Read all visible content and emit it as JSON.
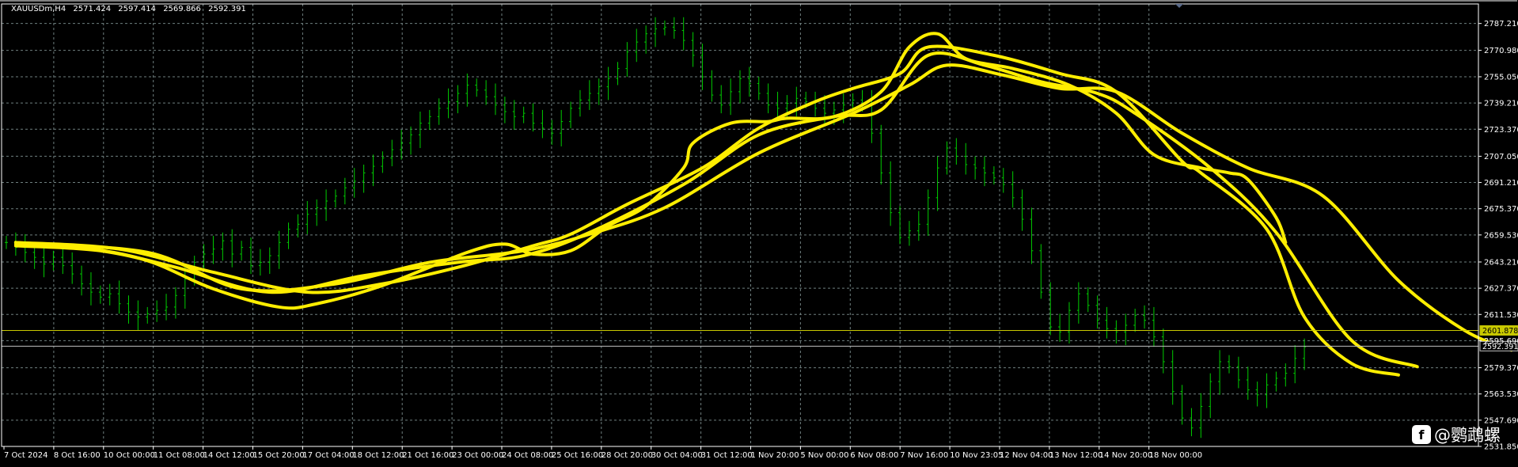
{
  "symbol_info": {
    "symbol": "XAUUSDm,H4",
    "open": "2571.424",
    "high": "2597.414",
    "low": "2569.866",
    "close": "2592.391"
  },
  "watermark": {
    "logo": "f",
    "text": "@鹦鹉螺"
  },
  "colors": {
    "background": "#000000",
    "grid": "#6f7f7f",
    "candle": "#00cc00",
    "ma": "#ffee00",
    "price_line": "#c8c800",
    "axis_text": "#ffffff"
  },
  "chart_data": {
    "type": "line",
    "title": "XAUUSDm,H4",
    "ylim": [
      2531.85,
      2799.0
    ],
    "y_ticks": [
      "2787.210",
      "2770.980",
      "2755.050",
      "2739.210",
      "2723.370",
      "2707.050",
      "2691.210",
      "2675.370",
      "2659.530",
      "2643.210",
      "2627.370",
      "2611.530",
      "2595.690",
      "2579.370",
      "2563.530",
      "2547.690",
      "2531.850"
    ],
    "x_labels": [
      "7 Oct 2024",
      "8 Oct 16:00",
      "10 Oct 00:00",
      "11 Oct 08:00",
      "14 Oct 12:00",
      "15 Oct 20:00",
      "17 Oct 04:00",
      "18 Oct 12:00",
      "21 Oct 16:00",
      "23 Oct 00:00",
      "24 Oct 08:00",
      "25 Oct 16:00",
      "28 Oct 20:00",
      "30 Oct 04:00",
      "31 Oct 12:00",
      "1 Nov 20:00",
      "5 Nov 00:00",
      "6 Nov 08:00",
      "7 Nov 16:00",
      "10 Nov 23:05",
      "12 Nov 04:00",
      "13 Nov 12:00",
      "14 Nov 20:00",
      "18 Nov 00:00"
    ],
    "price_lines": [
      {
        "value": 2601.878,
        "label": "2601.878",
        "color": "#c8c800"
      },
      {
        "value": 2592.391,
        "label": "2592.391",
        "color": "#c0c0c0"
      }
    ],
    "candles": {
      "color": "#00cc00",
      "series": [
        2655,
        2652,
        2649,
        2646,
        2642,
        2646,
        2641,
        2636,
        2630,
        2625,
        2622,
        2624,
        2618,
        2613,
        2610,
        2612,
        2614,
        2616,
        2623,
        2633,
        2643,
        2648,
        2651,
        2656,
        2648,
        2652,
        2641,
        2643,
        2647,
        2655,
        2663,
        2666,
        2672,
        2676,
        2680,
        2683,
        2688,
        2692,
        2697,
        2701,
        2706,
        2711,
        2715,
        2720,
        2727,
        2731,
        2736,
        2740,
        2745,
        2750,
        2747,
        2743,
        2738,
        2734,
        2731,
        2733,
        2727,
        2724,
        2721,
        2728,
        2736,
        2741,
        2745,
        2749,
        2754,
        2760,
        2770,
        2776,
        2781,
        2784,
        2785,
        2783,
        2777,
        2768,
        2755,
        2744,
        2738,
        2746,
        2754,
        2751,
        2745,
        2738,
        2736,
        2739,
        2742,
        2740,
        2736,
        2733,
        2735,
        2738,
        2741,
        2739,
        2721,
        2697,
        2673,
        2658,
        2662,
        2666,
        2682,
        2700,
        2712,
        2707,
        2702,
        2700,
        2697,
        2694,
        2690,
        2682,
        2669,
        2650,
        2625,
        2604,
        2601,
        2614,
        2624,
        2617,
        2608,
        2603,
        2601,
        2605,
        2611,
        2608,
        2598,
        2583,
        2565,
        2549,
        2543,
        2556,
        2571,
        2583,
        2580,
        2572,
        2566,
        2563,
        2569,
        2573,
        2576,
        2585,
        2592
      ]
    },
    "series": [
      {
        "color": "#ffee00",
        "x": [
          1,
          8,
          15,
          22,
          29,
          33,
          40,
          49,
          53,
          56,
          60,
          64,
          68,
          72,
          73,
          77,
          81,
          83,
          88,
          93,
          96,
          99,
          102,
          107,
          113,
          118,
          122,
          127,
          130,
          132,
          135,
          136
        ],
        "values": [
          2655,
          2652,
          2644,
          2627,
          2616,
          2618,
          2629,
          2649,
          2654,
          2648,
          2650,
          2665,
          2677,
          2700,
          2715,
          2727,
          2728,
          2730,
          2731,
          2746,
          2773,
          2781,
          2766,
          2760,
          2750,
          2733,
          2708,
          2700,
          2697,
          2693,
          2670,
          2655
        ]
      },
      {
        "color": "#ffee00",
        "x": [
          1,
          12,
          22,
          32,
          40,
          48,
          56,
          60,
          66,
          74,
          80,
          86,
          90,
          95,
          98,
          105,
          112,
          118,
          125,
          127,
          134,
          138,
          143,
          148
        ],
        "values": [
          2655,
          2651,
          2637,
          2625,
          2630,
          2640,
          2653,
          2660,
          2678,
          2700,
          2724,
          2740,
          2748,
          2757,
          2773,
          2768,
          2757,
          2746,
          2704,
          2697,
          2663,
          2610,
          2582,
          2575
        ]
      },
      {
        "color": "#ffee00",
        "x": [
          1,
          10,
          18,
          28,
          38,
          48,
          55,
          62,
          72,
          80,
          88,
          93,
          98,
          104,
          110,
          116,
          120,
          128,
          135,
          143,
          150
        ],
        "values": [
          2653,
          2650,
          2640,
          2625,
          2635,
          2643,
          2647,
          2661,
          2690,
          2720,
          2731,
          2735,
          2768,
          2762,
          2752,
          2745,
          2733,
          2700,
          2661,
          2596,
          2580
        ]
      },
      {
        "color": "#ffee00",
        "x": [
          1,
          15,
          25,
          35,
          45,
          55,
          62,
          70,
          80,
          90,
          96,
          100,
          106,
          112,
          118,
          125,
          132,
          140,
          148,
          155,
          160
        ],
        "values": [
          2654,
          2649,
          2627,
          2630,
          2643,
          2650,
          2660,
          2676,
          2709,
          2733,
          2750,
          2762,
          2756,
          2748,
          2746,
          2721,
          2700,
          2683,
          2632,
          2602,
          2590
        ]
      }
    ]
  }
}
